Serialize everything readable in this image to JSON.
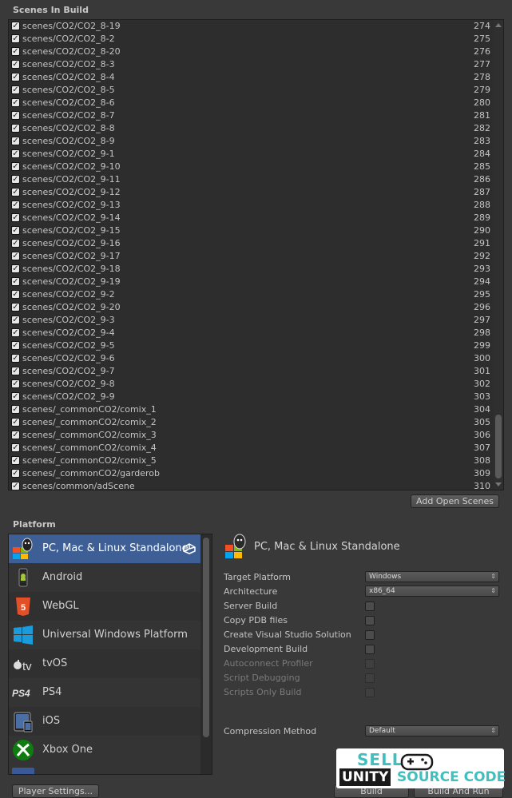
{
  "scenes_title": "Scenes In Build",
  "scenes": [
    {
      "path": "scenes/CO2/CO2_8-19",
      "index": "274"
    },
    {
      "path": "scenes/CO2/CO2_8-2",
      "index": "275"
    },
    {
      "path": "scenes/CO2/CO2_8-20",
      "index": "276"
    },
    {
      "path": "scenes/CO2/CO2_8-3",
      "index": "277"
    },
    {
      "path": "scenes/CO2/CO2_8-4",
      "index": "278"
    },
    {
      "path": "scenes/CO2/CO2_8-5",
      "index": "279"
    },
    {
      "path": "scenes/CO2/CO2_8-6",
      "index": "280"
    },
    {
      "path": "scenes/CO2/CO2_8-7",
      "index": "281"
    },
    {
      "path": "scenes/CO2/CO2_8-8",
      "index": "282"
    },
    {
      "path": "scenes/CO2/CO2_8-9",
      "index": "283"
    },
    {
      "path": "scenes/CO2/CO2_9-1",
      "index": "284"
    },
    {
      "path": "scenes/CO2/CO2_9-10",
      "index": "285"
    },
    {
      "path": "scenes/CO2/CO2_9-11",
      "index": "286"
    },
    {
      "path": "scenes/CO2/CO2_9-12",
      "index": "287"
    },
    {
      "path": "scenes/CO2/CO2_9-13",
      "index": "288"
    },
    {
      "path": "scenes/CO2/CO2_9-14",
      "index": "289"
    },
    {
      "path": "scenes/CO2/CO2_9-15",
      "index": "290"
    },
    {
      "path": "scenes/CO2/CO2_9-16",
      "index": "291"
    },
    {
      "path": "scenes/CO2/CO2_9-17",
      "index": "292"
    },
    {
      "path": "scenes/CO2/CO2_9-18",
      "index": "293"
    },
    {
      "path": "scenes/CO2/CO2_9-19",
      "index": "294"
    },
    {
      "path": "scenes/CO2/CO2_9-2",
      "index": "295"
    },
    {
      "path": "scenes/CO2/CO2_9-20",
      "index": "296"
    },
    {
      "path": "scenes/CO2/CO2_9-3",
      "index": "297"
    },
    {
      "path": "scenes/CO2/CO2_9-4",
      "index": "298"
    },
    {
      "path": "scenes/CO2/CO2_9-5",
      "index": "299"
    },
    {
      "path": "scenes/CO2/CO2_9-6",
      "index": "300"
    },
    {
      "path": "scenes/CO2/CO2_9-7",
      "index": "301"
    },
    {
      "path": "scenes/CO2/CO2_9-8",
      "index": "302"
    },
    {
      "path": "scenes/CO2/CO2_9-9",
      "index": "303"
    },
    {
      "path": "scenes/_commonCO2/comix_1",
      "index": "304"
    },
    {
      "path": "scenes/_commonCO2/comix_2",
      "index": "305"
    },
    {
      "path": "scenes/_commonCO2/comix_3",
      "index": "306"
    },
    {
      "path": "scenes/_commonCO2/comix_4",
      "index": "307"
    },
    {
      "path": "scenes/_commonCO2/comix_5",
      "index": "308"
    },
    {
      "path": "scenes/_commonCO2/garderob",
      "index": "309"
    },
    {
      "path": "scenes/common/adScene",
      "index": "310"
    }
  ],
  "add_open_scenes_label": "Add Open Scenes",
  "platform_title": "Platform",
  "platforms": [
    {
      "label": "PC, Mac & Linux Standalone",
      "icon": "windows-standalone-icon",
      "selected": true
    },
    {
      "label": "Android",
      "icon": "android-icon"
    },
    {
      "label": "WebGL",
      "icon": "html5-icon"
    },
    {
      "label": "Universal Windows Platform",
      "icon": "windows-logo-icon"
    },
    {
      "label": "tvOS",
      "icon": "apple-tv-icon"
    },
    {
      "label": "PS4",
      "icon": "ps4-logo-icon"
    },
    {
      "label": "iOS",
      "icon": "ipad-icon"
    },
    {
      "label": "Xbox One",
      "icon": "xbox-icon"
    }
  ],
  "settings": {
    "platform_heading": "PC, Mac & Linux Standalone",
    "target_platform_label": "Target Platform",
    "target_platform_value": "Windows",
    "architecture_label": "Architecture",
    "architecture_value": "x86_64",
    "server_build_label": "Server Build",
    "copy_pdb_label": "Copy PDB files",
    "create_vs_label": "Create Visual Studio Solution",
    "development_build_label": "Development Build",
    "autoconnect_label": "Autoconnect Profiler",
    "script_debugging_label": "Script Debugging",
    "scripts_only_label": "Scripts Only Build",
    "compression_label": "Compression Method",
    "compression_value": "Default"
  },
  "footer": {
    "player_settings_label": "Player Settings...",
    "build_label": "Build",
    "build_and_run_label": "Build And Run"
  },
  "watermark": {
    "line1": "SELL",
    "line2a": "UNITY",
    "line2b": "SOURCE CODE"
  },
  "colors": {
    "selected_row": "#3e5f96",
    "watermark_teal": "#3fc0bf"
  }
}
